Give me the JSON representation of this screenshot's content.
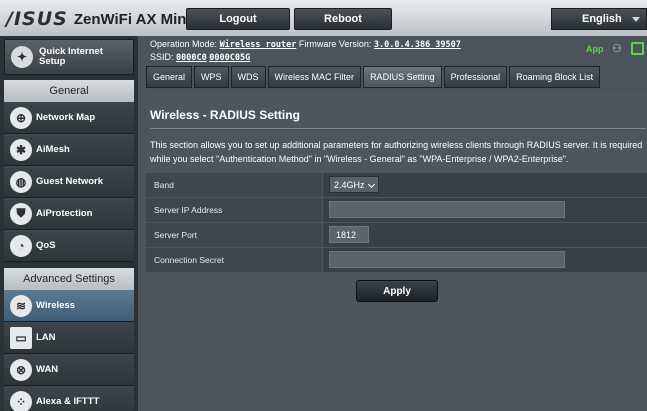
{
  "header": {
    "brand": "/ISUS",
    "model": "ZenWiFi AX Mini",
    "logout_label": "Logout",
    "reboot_label": "Reboot",
    "language": "English"
  },
  "sidebar": {
    "quick_setup": "Quick Internet Setup",
    "general_title": "General",
    "general_items": [
      {
        "label": "Network Map",
        "icon": "network-map-icon"
      },
      {
        "label": "AiMesh",
        "icon": "aimesh-icon"
      },
      {
        "label": "Guest Network",
        "icon": "guest-network-icon"
      },
      {
        "label": "AiProtection",
        "icon": "shield-icon"
      },
      {
        "label": "QoS",
        "icon": "gauge-icon"
      }
    ],
    "advanced_title": "Advanced Settings",
    "advanced_items": [
      {
        "label": "Wireless",
        "icon": "wifi-icon"
      },
      {
        "label": "LAN",
        "icon": "monitor-icon"
      },
      {
        "label": "WAN",
        "icon": "globe-icon"
      },
      {
        "label": "Alexa & IFTTT",
        "icon": "alexa-icon"
      }
    ]
  },
  "status": {
    "op_mode_label": "Operation Mode:",
    "op_mode": "Wireless router",
    "fw_label": "Firmware Version:",
    "fw": "3.0.0.4.386_39507",
    "ssid_label": "SSID:",
    "ssid1": "0000C0",
    "ssid2": "0000C05G",
    "app_label": "App"
  },
  "tabs": [
    {
      "label": "General"
    },
    {
      "label": "WPS"
    },
    {
      "label": "WDS"
    },
    {
      "label": "Wireless MAC Filter"
    },
    {
      "label": "RADIUS Setting"
    },
    {
      "label": "Professional"
    },
    {
      "label": "Roaming Block List"
    }
  ],
  "page": {
    "title": "Wireless - RADIUS Setting",
    "description": "This section allows you to set up additional parameters for authorizing wireless clients through RADIUS server. It is required while you select \"Authentication Method\" in \"Wireless - General\" as \"WPA-Enterprise / WPA2-Enterprise\".",
    "rows": {
      "band_label": "Band",
      "band_value": "2.4GHz",
      "server_ip_label": "Server IP Address",
      "server_ip_value": "",
      "server_port_label": "Server Port",
      "server_port_value": "1812",
      "secret_label": "Connection Secret",
      "secret_value": ""
    },
    "apply_label": "Apply"
  },
  "colors": {
    "accent_green": "#5bd34b",
    "active_nav": "#4f6d84"
  }
}
